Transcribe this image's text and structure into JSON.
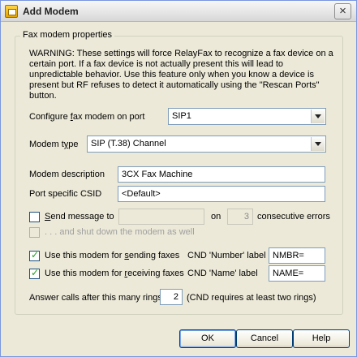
{
  "window": {
    "title": "Add Modem",
    "close_glyph": "×"
  },
  "group": {
    "label": "Fax modem properties"
  },
  "warning": "WARNING:  These settings will force RelayFax to recognize a fax device on a certain port.  If a fax device is not actually present this will lead to unpredictable behavior.  Use this feature only when you know a device is present but RF refuses to detect it automatically using the \"Rescan Ports\" button.",
  "port": {
    "label_before": "Configure ",
    "label_hot": "f",
    "label_after": "ax modem on port",
    "value": "SIP1"
  },
  "modem_type": {
    "label_before": "Modem t",
    "label_hot": "y",
    "label_after": "pe",
    "value": "SIP (T.38) Channel"
  },
  "description": {
    "label": "Modem description",
    "value": "3CX Fax Machine"
  },
  "csid": {
    "label": "Port specific CSID",
    "value": "<Default>"
  },
  "send_message": {
    "label_before": "",
    "label_hot": "S",
    "label_after": "end message to",
    "checked": false,
    "recipient": "",
    "on_label": "on",
    "count": "3",
    "errors_label": "consecutive errors"
  },
  "shutdown": {
    "label": ". . . and shut down the modem as well",
    "checked": false,
    "enabled": false
  },
  "sending": {
    "label_before": "Use this modem for ",
    "label_hot": "s",
    "label_after": "ending faxes",
    "checked": true,
    "cnd_label": "CND 'Number' label",
    "cnd_value": "NMBR="
  },
  "receiving": {
    "label_before": "Use this modem for ",
    "label_hot": "r",
    "label_after": "eceiving faxes",
    "checked": true,
    "cnd_label": "CND 'Name' label",
    "cnd_value": "NAME="
  },
  "rings": {
    "label": "Answer calls after this many rings",
    "value": "2",
    "note": "(CND requires at least two rings)"
  },
  "buttons": {
    "ok": "OK",
    "cancel": "Cancel",
    "help": "Help"
  },
  "icons": {
    "app": "fax-modem-icon",
    "close": "close-icon",
    "dropdown": "chevron-down-icon",
    "check": "check-icon"
  },
  "colors": {
    "dialog_bg": "#ece9d8",
    "field_border": "#7f9db9",
    "check_mark": "#21a121"
  }
}
